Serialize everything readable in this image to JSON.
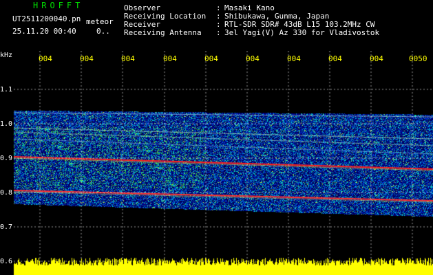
{
  "header": {
    "station_name": "HROFFT",
    "filename": "UT2511200040.pn",
    "mode": "meteor",
    "datetime": "25.11.20 00:40",
    "count": "0..",
    "fields": [
      {
        "label": "Observer",
        "sep": ":",
        "value": "Masaki Kano"
      },
      {
        "label": "Receiving Location",
        "sep": ":",
        "value": "Shibukawa, Gunma, Japan"
      },
      {
        "label": "Receiver",
        "sep": ":",
        "value": "RTL-SDR SDR# 43dB L15 103.2MHz CW"
      },
      {
        "label": "Receiving Antenna",
        "sep": ":",
        "value": "3el Yagi(V) Az 330 for Vladivostok"
      }
    ]
  },
  "axis": {
    "unit": "kHz",
    "y_ticks": [
      "1.1",
      "1.0",
      "0.9",
      "0.8",
      "0.7",
      "0.6"
    ],
    "x_ticks": [
      "004",
      "004",
      "004",
      "004",
      "004",
      "004",
      "004",
      "004",
      "004",
      "0050"
    ]
  },
  "colors": {
    "background": "#000000",
    "header_text": "#ffffff",
    "station_name": "#00e000",
    "time_labels": "#ffff00",
    "grid": "#ffffff",
    "echo_line": "#ff2020"
  }
}
